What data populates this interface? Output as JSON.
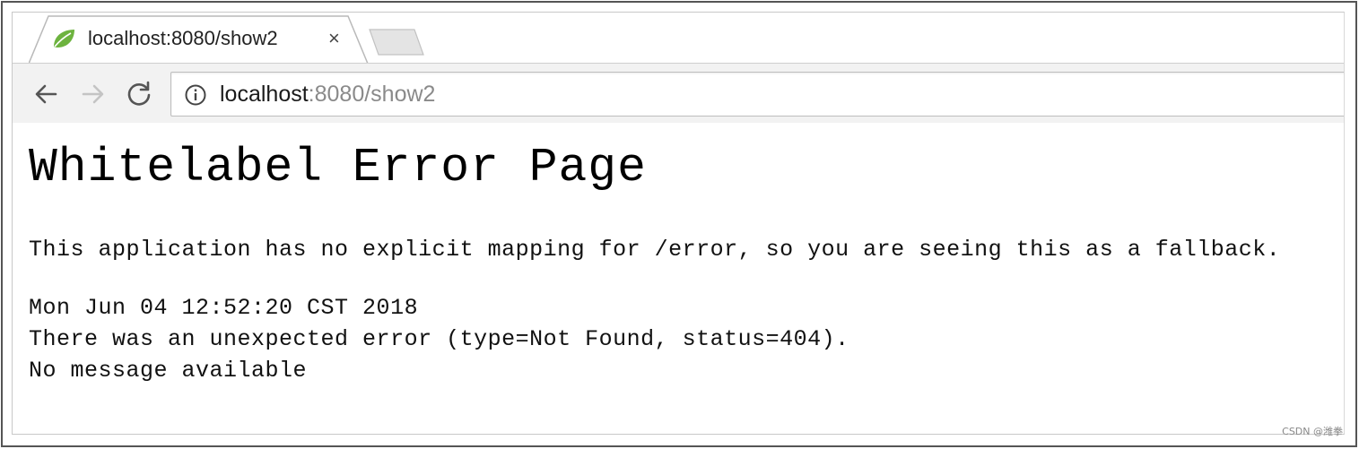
{
  "browser": {
    "tab": {
      "title": "localhost:8080/show2",
      "close_glyph": "×",
      "favicon": "spring-leaf-icon"
    },
    "toolbar": {
      "back_icon": "arrow-left-icon",
      "forward_icon": "arrow-right-icon",
      "reload_icon": "reload-icon",
      "site_info_icon": "info-circle-icon",
      "url_host": "localhost",
      "url_rest": ":8080/show2"
    }
  },
  "page": {
    "title": "Whitelabel Error Page",
    "fallback_text": "This application has no explicit mapping for /error, so you are seeing this as a fallback.",
    "timestamp": "Mon Jun 04 12:52:20 CST 2018",
    "error_text": "There was an unexpected error (type=Not Found, status=404).",
    "message": "No message available"
  },
  "watermark": "CSDN @潍拳",
  "colors": {
    "toolbar_bg": "#f2f2f2",
    "favicon_green": "#6db33f",
    "url_host": "#1a1a1a",
    "url_rest": "#8a8a8a"
  }
}
